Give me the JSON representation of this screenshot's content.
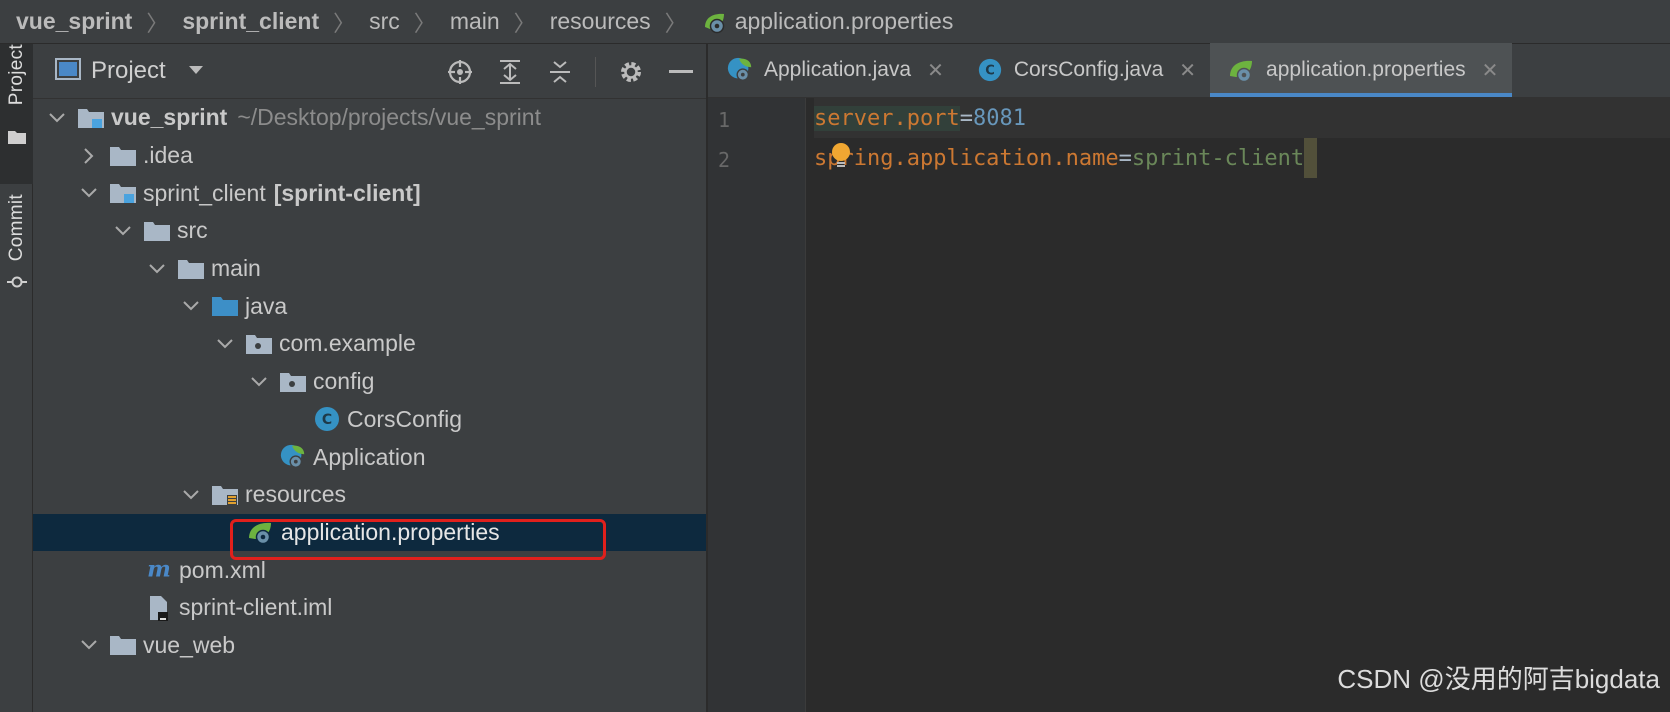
{
  "breadcrumb": {
    "items": [
      "vue_sprint",
      "sprint_client",
      "src",
      "main",
      "resources",
      "application.properties"
    ]
  },
  "toolstrip": {
    "project_label": "Project",
    "commit_label": "Commit"
  },
  "project_panel": {
    "title": "Project",
    "tree": [
      {
        "label": "vue_sprint",
        "hint": "~/Desktop/projects/vue_sprint"
      },
      {
        "label": ".idea"
      },
      {
        "label": "sprint_client",
        "hint": "[sprint-client]"
      },
      {
        "label": "src"
      },
      {
        "label": "main"
      },
      {
        "label": "java"
      },
      {
        "label": "com.example"
      },
      {
        "label": "config"
      },
      {
        "label": "CorsConfig"
      },
      {
        "label": "Application"
      },
      {
        "label": "resources"
      },
      {
        "label": "application.properties"
      },
      {
        "label": "pom.xml"
      },
      {
        "label": "sprint-client.iml"
      },
      {
        "label": "vue_web"
      }
    ]
  },
  "editor": {
    "tabs": [
      {
        "label": "Application.java"
      },
      {
        "label": "CorsConfig.java"
      },
      {
        "label": "application.properties"
      }
    ],
    "lines": [
      {
        "number": "1",
        "key": "server.port",
        "eq": "=",
        "value": "8081"
      },
      {
        "number": "2",
        "key": "spring.application.name",
        "eq": "=",
        "value": "sprint-client"
      }
    ]
  },
  "watermark": "CSDN @没用的阿吉bigdata",
  "colors": {
    "accent": "#4a88c7",
    "highlight_box": "#e0201c",
    "selected_row": "#0d293e",
    "keyword": "#cc7832",
    "number": "#6897bb",
    "string": "#6a8759",
    "spring_leaf": "#6db33f"
  }
}
